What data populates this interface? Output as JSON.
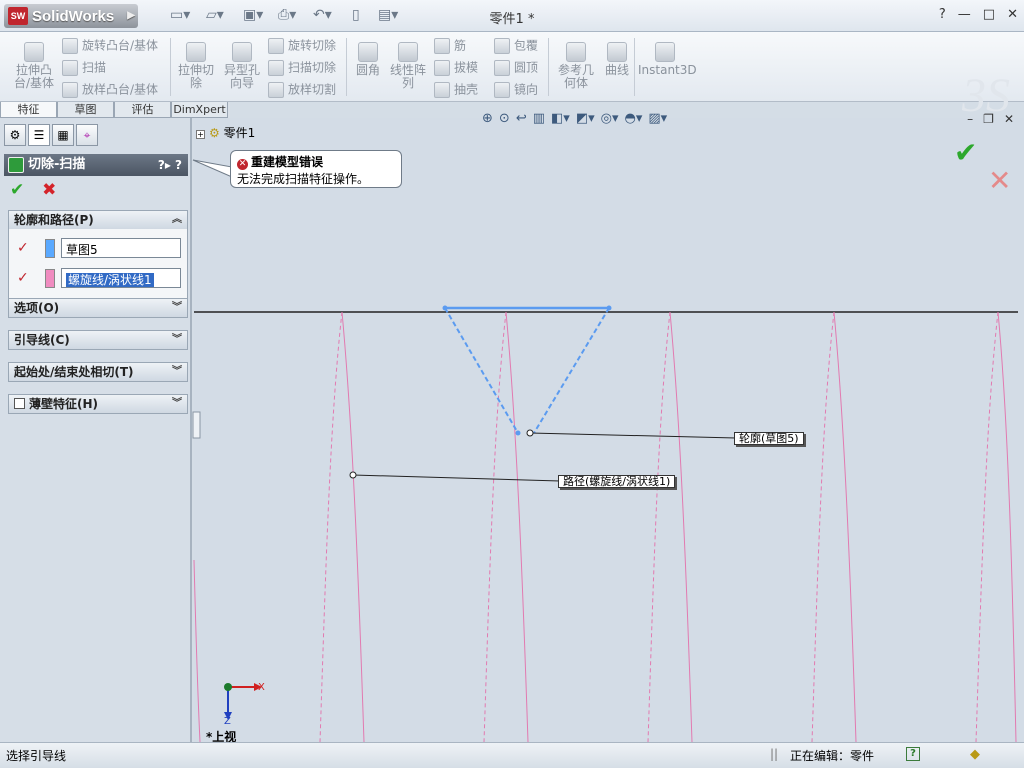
{
  "app": {
    "name": "SolidWorks",
    "logo_abbr": "SW",
    "document_title": "零件1 *"
  },
  "window_controls": {
    "help": "?",
    "minimize": "—",
    "maximize": "□",
    "close": "✕"
  },
  "command_manager": {
    "extrude_boss": "拉伸凸台/基体",
    "revolve_boss": "旋转凸台/基体",
    "sweep": "扫描",
    "loft_boss": "放样凸台/基体",
    "extrude_cut": "拉伸切除",
    "hole_wizard": "异型孔向导",
    "revolve_cut": "旋转切除",
    "swept_cut": "扫描切除",
    "lofted_cut": "放样切割",
    "fillet": "圆角",
    "linear_pattern": "线性阵列",
    "rib": "筋",
    "draft": "拔模",
    "shell": "抽壳",
    "wrap": "包覆",
    "dome": "圆顶",
    "mirror": "镜向",
    "ref_geometry": "参考几何体",
    "curves": "曲线",
    "instant3d": "Instant3D"
  },
  "tabs": [
    {
      "label": "特征"
    },
    {
      "label": "草图"
    },
    {
      "label": "评估"
    },
    {
      "label": "DimXpert"
    }
  ],
  "property_manager": {
    "title": "切除-扫描",
    "help": "?",
    "groups": {
      "profile_path": {
        "label": "轮廓和路径(P)",
        "profile_value": "草图5",
        "path_value": "螺旋线/涡状线1"
      },
      "options": {
        "label": "选项(O)"
      },
      "guide_curves": {
        "label": "引导线(C)"
      },
      "start_end_tangency": {
        "label": "起始处/结束处相切(T)"
      },
      "thin_feature": {
        "label": "薄壁特征(H)"
      }
    }
  },
  "callout": {
    "title": "重建模型错误",
    "message": "无法完成扫描特征操作。"
  },
  "tree": {
    "root": "零件1"
  },
  "graphics": {
    "profile_tag": "轮廓(草图5)",
    "path_tag": "路径(螺旋线/涡状线1)",
    "view_name": "*上视",
    "axis_x": "X",
    "axis_z": "Z"
  },
  "status_bar": {
    "hint": "选择引导线",
    "editing": "正在编辑：零件"
  },
  "colors": {
    "profile_line": "#5b9bf0",
    "helix_line": "#e27ab0",
    "swatch_blue": "#5aa9ff",
    "swatch_pink": "#f08cc0"
  }
}
